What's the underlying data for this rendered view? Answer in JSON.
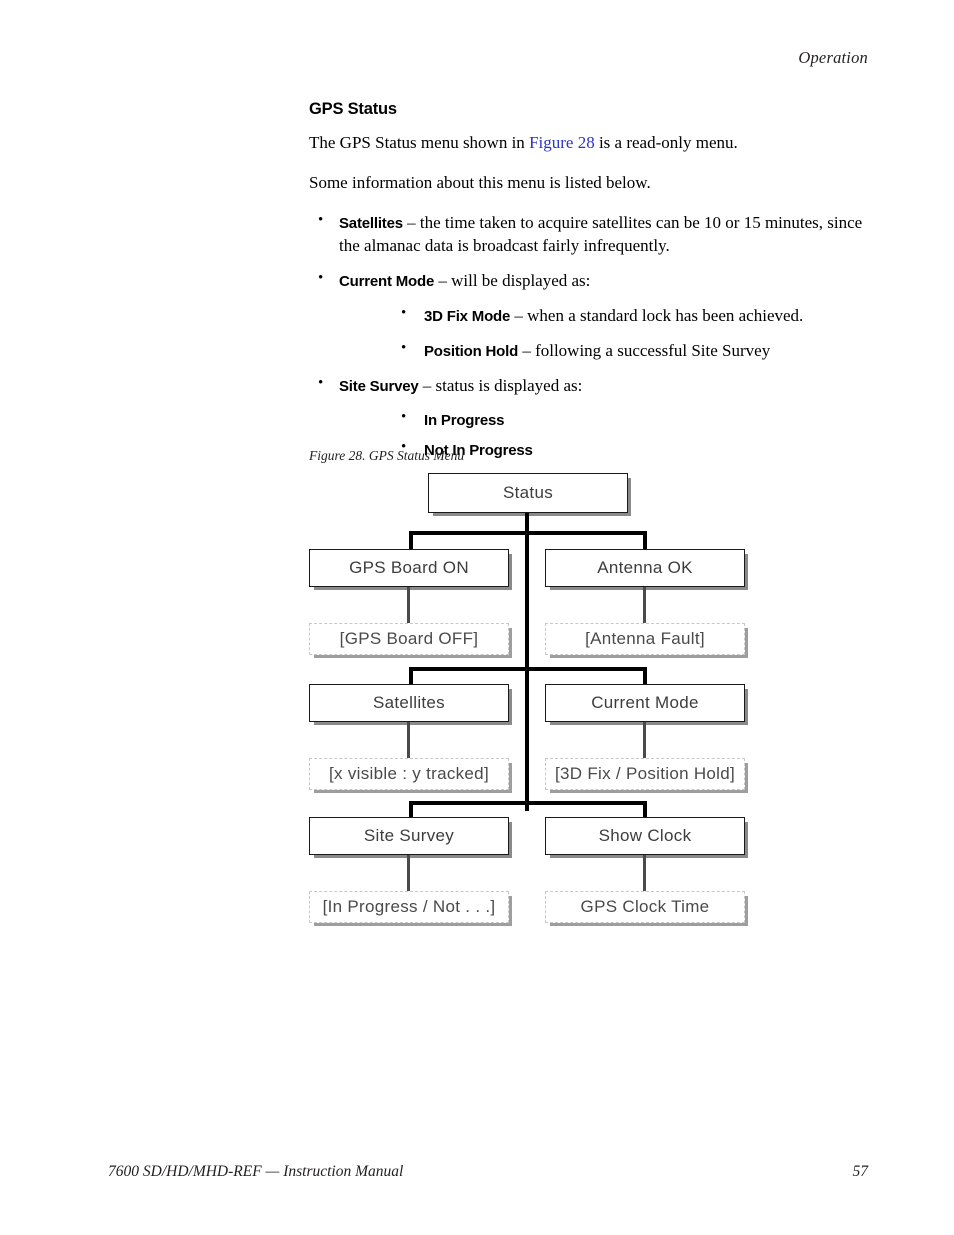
{
  "page": {
    "running_head": "Operation",
    "footer_left": "7600 SD/HD/MHD-REF — Instruction Manual",
    "footer_page": "57"
  },
  "section": {
    "title": "GPS Status",
    "intro_before": "The GPS Status menu shown in ",
    "intro_link": "Figure 28",
    "intro_after": " is a read-only menu.",
    "lead_in": "Some information about this menu is listed below."
  },
  "bullets": {
    "satellites": {
      "term": "Satellites",
      "text": " – the time taken to acquire satellites can be 10 or 15 minutes, since the almanac data is broadcast fairly infrequently."
    },
    "current_mode": {
      "term": "Current Mode",
      "text": " – will be displayed as:"
    },
    "three_d_fix": {
      "term": "3D Fix Mode",
      "text": " – when a standard lock has been achieved."
    },
    "position_hold": {
      "term": "Position Hold",
      "text": " – following a successful Site Survey"
    },
    "site_survey": {
      "term": "Site Survey",
      "text": " – status is displayed as:"
    },
    "in_progress": {
      "term": "In Progress",
      "text": ""
    },
    "not_in_progress": {
      "term": "Not In Progress",
      "text": ""
    }
  },
  "figure": {
    "caption": "Figure 28.  GPS Status Menu",
    "nodes": {
      "status": "Status",
      "gps_board_on": "GPS Board ON",
      "gps_board_off": "[GPS Board OFF]",
      "antenna_ok": "Antenna OK",
      "antenna_fault": "[Antenna Fault]",
      "satellites": "Satellites",
      "satellites_value": "[x visible : y tracked]",
      "current_mode": "Current Mode",
      "current_mode_value": "[3D Fix / Position Hold]",
      "site_survey": "Site Survey",
      "site_survey_value": "[In Progress / Not . . .]",
      "show_clock": "Show Clock",
      "gps_clock_time": "GPS Clock Time"
    }
  },
  "colors": {
    "link": "#2b35c8",
    "node_border": "#1a1a1a",
    "node_dashed_border": "#c8c8c8",
    "shadow": "#8a8a8a"
  }
}
